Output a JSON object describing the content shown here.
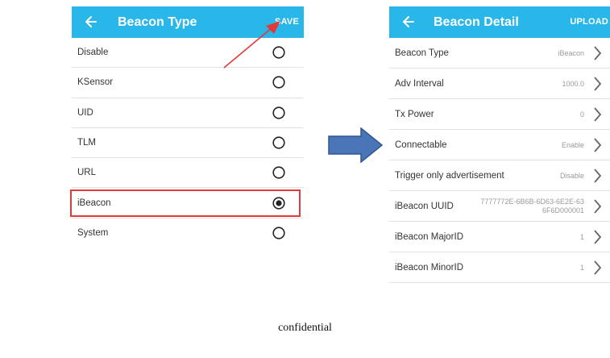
{
  "left": {
    "title": "Beacon Type",
    "action": "SAVE",
    "items": [
      {
        "label": "Disable",
        "selected": false
      },
      {
        "label": "KSensor",
        "selected": false
      },
      {
        "label": "UID",
        "selected": false
      },
      {
        "label": "TLM",
        "selected": false
      },
      {
        "label": "URL",
        "selected": false
      },
      {
        "label": "iBeacon",
        "selected": true
      },
      {
        "label": "System",
        "selected": false
      }
    ]
  },
  "right": {
    "title": "Beacon Detail",
    "action": "UPLOAD",
    "items": [
      {
        "label": "Beacon Type",
        "value": "iBeacon"
      },
      {
        "label": "Adv Interval",
        "value": "1000.0"
      },
      {
        "label": "Tx Power",
        "value": "0"
      },
      {
        "label": "Connectable",
        "value": "Enable"
      },
      {
        "label": "Trigger only advertisement",
        "value": "Disable"
      },
      {
        "label": "iBeacon UUID",
        "value": "7777772E-6B6B-6D63-6E2E-63 6F6D000001"
      },
      {
        "label": "iBeacon MajorID",
        "value": "1"
      },
      {
        "label": "iBeacon MinorID",
        "value": "1"
      }
    ]
  },
  "footer": "confidential",
  "colors": {
    "appbar": "#29b6e8",
    "highlight": "#e23a3a",
    "arrow": "#4a76b8"
  }
}
